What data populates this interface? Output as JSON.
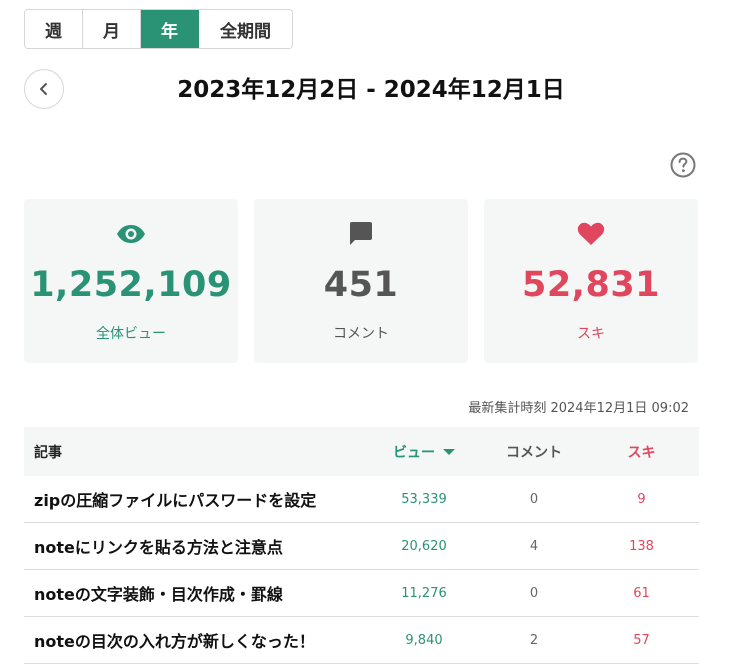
{
  "period_tabs": [
    "週",
    "月",
    "年",
    "全期間"
  ],
  "active_tab": "年",
  "date_range": "2023年12月2日  -  2024年12月1日",
  "stats": {
    "views": {
      "value": "1,252,109",
      "label": "全体ビュー",
      "icon": "eye-icon"
    },
    "comments": {
      "value": "451",
      "label": "コメント",
      "icon": "comment-icon"
    },
    "likes": {
      "value": "52,831",
      "label": "スキ",
      "icon": "heart-icon"
    }
  },
  "timestamp": "最新集計時刻 2024年12月1日 09:02",
  "table": {
    "headers": {
      "title": "記事",
      "views": "ビュー",
      "comments": "コメント",
      "likes": "スキ"
    },
    "rows": [
      {
        "title": "zipの圧縮ファイルにパスワードを設定",
        "views": "53,339",
        "comments": "0",
        "likes": "9"
      },
      {
        "title": "noteにリンクを貼る方法と注意点",
        "views": "20,620",
        "comments": "4",
        "likes": "138"
      },
      {
        "title": "noteの文字装飾・目次作成・罫線",
        "views": "11,276",
        "comments": "0",
        "likes": "61"
      },
      {
        "title": "noteの目次の入れ方が新しくなった！",
        "views": "9,840",
        "comments": "2",
        "likes": "57"
      }
    ]
  },
  "colors": {
    "accent": "#2a9375",
    "like": "#e0475e",
    "card_bg": "#f4f7f6"
  }
}
